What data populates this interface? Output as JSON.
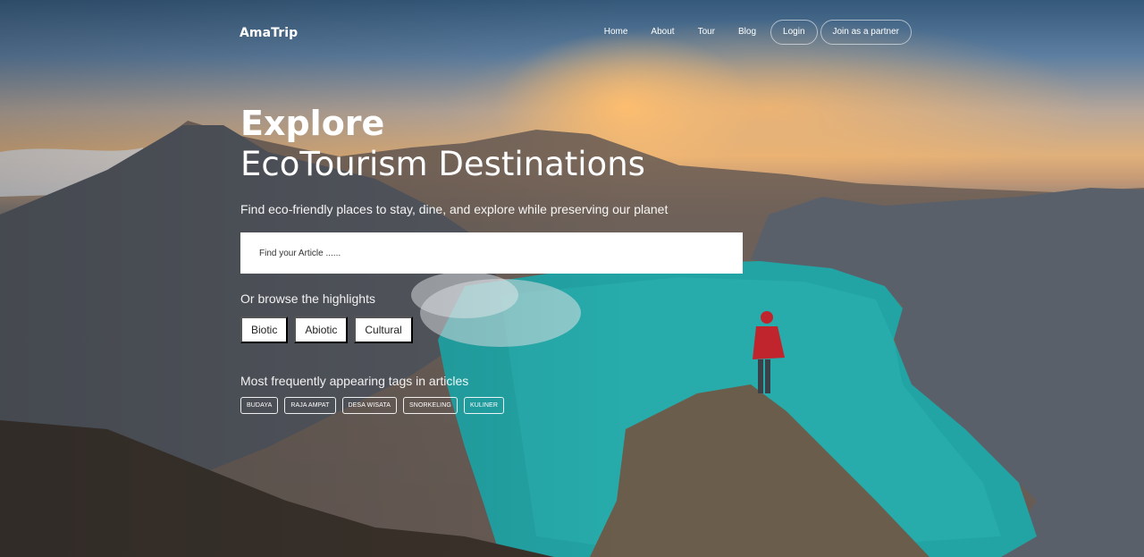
{
  "brand": {
    "name": "AmaTrip"
  },
  "nav": {
    "items": [
      "Home",
      "About",
      "Tour",
      "Blog"
    ],
    "login": "Login",
    "partner": "Join as a partner"
  },
  "hero": {
    "title_bold": "Explore",
    "title_regular": "EcoTourism Destinations",
    "subtitle": "Find eco-friendly places to stay, dine, and explore while preserving our planet"
  },
  "search": {
    "placeholder": "Find your Article ......",
    "value": ""
  },
  "highlights": {
    "label": "Or browse the highlights",
    "items": [
      "Biotic",
      "Abiotic",
      "Cultural"
    ]
  },
  "tags": {
    "label": "Most frequently appearing tags in articles",
    "items": [
      "BUDAYA",
      "RAJA AMPAT",
      "DESA WISATA",
      "SNORKELING",
      "KULINER"
    ]
  },
  "colors": {
    "search_bg": "#ffffff",
    "chip_bg": "#ffffff",
    "text": "#ffffff"
  }
}
